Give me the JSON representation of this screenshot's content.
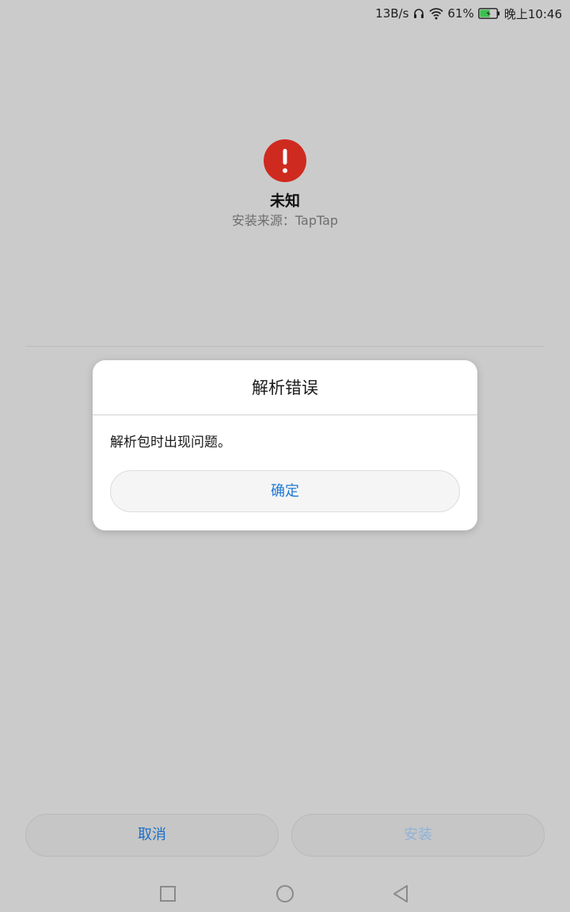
{
  "status_bar": {
    "network_speed": "13B/s",
    "battery_percent": "61%",
    "battery_level": 0.61,
    "battery_charging": true,
    "time": "晚上10:46",
    "icons": [
      "headset-icon",
      "wifi-icon",
      "battery-icon"
    ]
  },
  "app": {
    "icon": "error-icon",
    "name": "未知",
    "source": "安装来源：TapTap"
  },
  "dialog": {
    "title": "解析错误",
    "message": "解析包时出现问题。",
    "confirm_label": "确定"
  },
  "actions": {
    "cancel_label": "取消",
    "install_label": "安装"
  },
  "nav_bar": {
    "icons": [
      "recent-apps-icon",
      "home-icon",
      "back-icon"
    ]
  },
  "colors": {
    "error_red": "#cf2a1f",
    "accent_blue": "#1e78d7",
    "disabled_blue": "#8fb2d8",
    "dim_background": "#cbcbcb",
    "battery_green": "#3dbf4e"
  }
}
